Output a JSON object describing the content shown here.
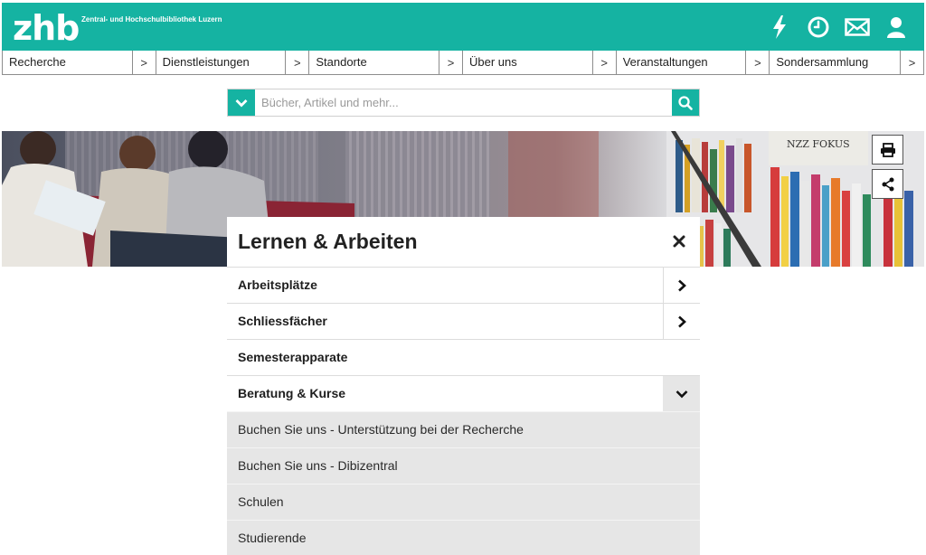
{
  "header": {
    "logo": "zhb",
    "subtitle": "Zentral- und Hochschulbibliothek Luzern",
    "brand_color": "#15b3a2",
    "icons": [
      "lightning-icon",
      "clock-icon",
      "mail-icon",
      "user-icon"
    ]
  },
  "nav": {
    "items": [
      {
        "label": "Recherche",
        "chevron": ">"
      },
      {
        "label": "Dienstleistungen",
        "chevron": ">"
      },
      {
        "label": "Standorte",
        "chevron": ">"
      },
      {
        "label": "Über uns",
        "chevron": ">"
      },
      {
        "label": "Veranstaltungen",
        "chevron": ">"
      },
      {
        "label": "Sondersammlung",
        "chevron": ">"
      }
    ]
  },
  "search": {
    "placeholder": "Bücher, Artikel und mehr...",
    "value": ""
  },
  "hero": {
    "book_spine_text": "NZZ FOKUS",
    "side_icons": [
      "print-icon",
      "share-icon"
    ]
  },
  "panel": {
    "title": "Lernen & Arbeiten",
    "items": [
      {
        "label": "Arbeitsplätze",
        "arrow": "chevron-right"
      },
      {
        "label": "Schliessfächer",
        "arrow": "chevron-right"
      },
      {
        "label": "Semesterapparate",
        "arrow": "none"
      },
      {
        "label": "Beratung & Kurse",
        "arrow": "chevron-down"
      }
    ],
    "subitems": [
      {
        "label": "Buchen Sie uns - Unterstützung bei der Recherche"
      },
      {
        "label": "Buchen Sie uns - Dibizentral"
      },
      {
        "label": "Schulen"
      },
      {
        "label": "Studierende"
      }
    ]
  }
}
